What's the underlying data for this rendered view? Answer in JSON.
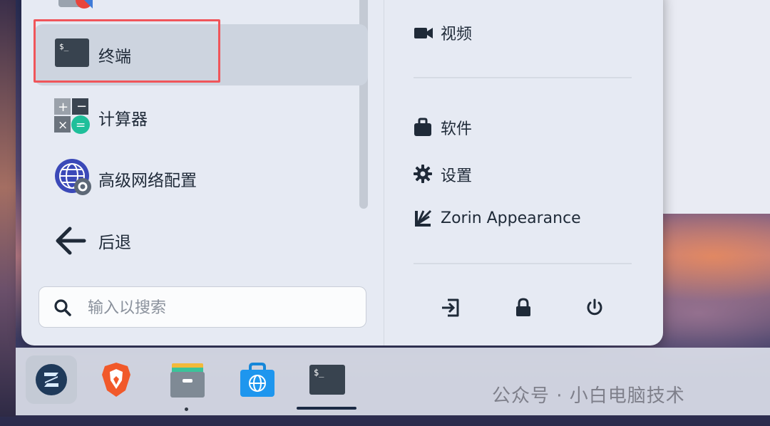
{
  "colors": {
    "menu_bg": "#e6eaf3",
    "selected_bg": "#cdd4df",
    "highlight_border": "#f0555a",
    "text": "#1f2a38",
    "taskbar_bg": "#dadee8"
  },
  "apps": [
    {
      "label": "终端",
      "icon": "terminal-icon",
      "selected": true
    },
    {
      "label": "计算器",
      "icon": "calculator-icon"
    },
    {
      "label": "高级网络配置",
      "icon": "network-settings-icon"
    },
    {
      "label": "后退",
      "icon": "back-arrow-icon"
    }
  ],
  "search": {
    "placeholder": "输入以搜索",
    "value": ""
  },
  "right": {
    "items": [
      {
        "label": "视频",
        "icon": "video-icon"
      },
      {
        "label": "软件",
        "icon": "software-bag-icon"
      },
      {
        "label": "设置",
        "icon": "settings-gear-icon"
      },
      {
        "label": "Zorin Appearance",
        "icon": "zorin-appearance-icon"
      }
    ],
    "power": [
      {
        "icon": "logout-icon"
      },
      {
        "icon": "lock-icon"
      },
      {
        "icon": "power-icon"
      }
    ]
  },
  "taskbar": {
    "apps": [
      {
        "icon": "zorin-menu-icon"
      },
      {
        "icon": "brave-browser-icon"
      },
      {
        "icon": "files-icon"
      },
      {
        "icon": "software-store-icon"
      },
      {
        "icon": "terminal-icon"
      }
    ]
  },
  "watermark": "公众号 · 小白电脑技术"
}
